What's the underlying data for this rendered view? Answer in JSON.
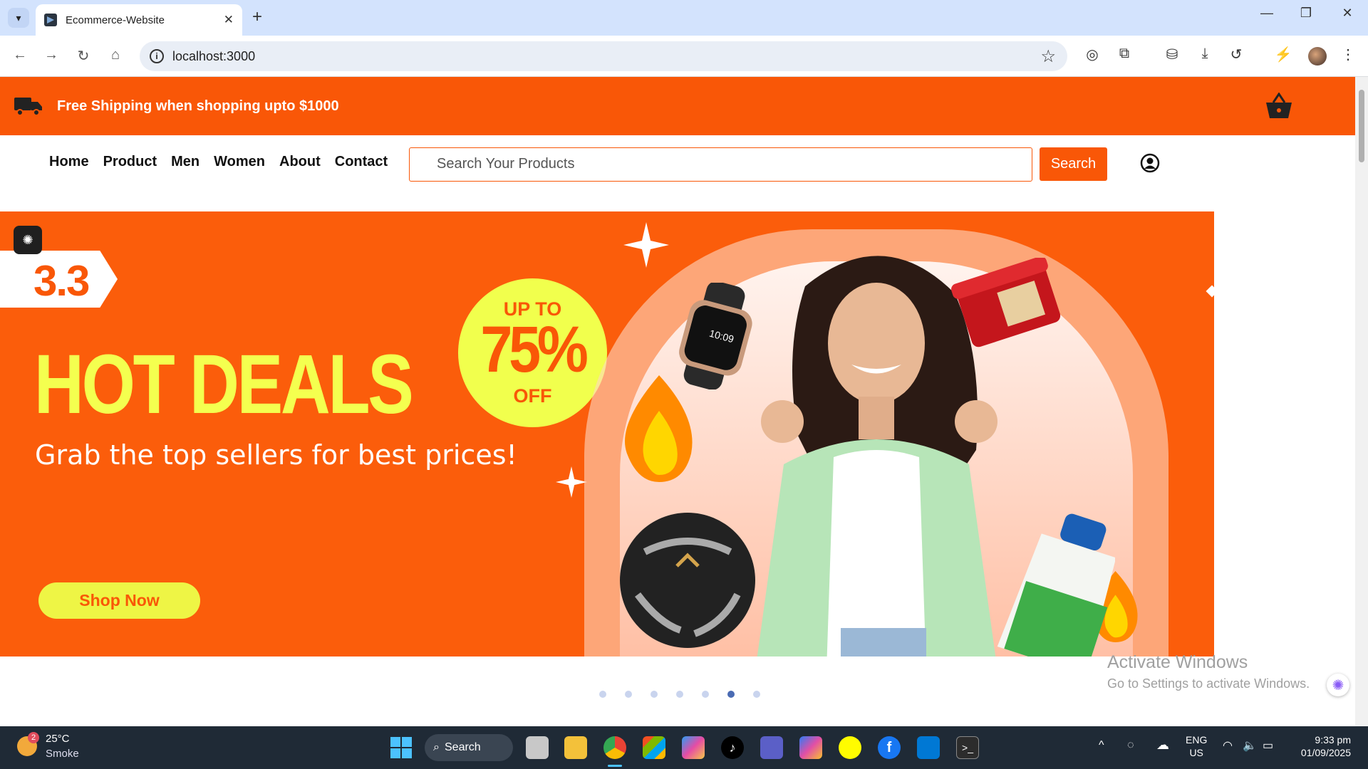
{
  "browser": {
    "tab_title": "Ecommerce-Website",
    "url": "localhost:3000"
  },
  "site": {
    "shipping_text": "Free Shipping when shopping upto $1000",
    "nav": [
      "Home",
      "Product",
      "Men",
      "Women",
      "About",
      "Contact"
    ],
    "search_placeholder": "Search Your Products",
    "search_button": "Search"
  },
  "banner": {
    "tag": "3.3",
    "headline": "HOT DEALS",
    "subheadline": "Grab the top sellers for best prices!",
    "discount_top": "UP TO",
    "discount_value": "75%",
    "discount_bottom": "OFF",
    "cta": "Shop Now",
    "slide_count": 7,
    "active_slide": 6
  },
  "watermark": {
    "line1": "Activate Windows",
    "line2": "Go to Settings to activate Windows."
  },
  "taskbar": {
    "weather_temp": "25°C",
    "weather_desc": "Smoke",
    "weather_badge": "2",
    "search_label": "Search",
    "lang1": "ENG",
    "lang2": "US",
    "time": "9:33 pm",
    "date": "01/09/2025"
  }
}
